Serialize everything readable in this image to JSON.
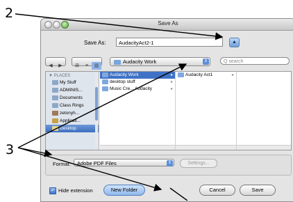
{
  "callouts": {
    "two": "2",
    "three": "3"
  },
  "dialog": {
    "title": "Save As",
    "save_as_label": "Save As:",
    "save_as_value": "AudacityAct2-1",
    "expand_symbol": "▲"
  },
  "toolbar": {
    "back": "◀",
    "forward": "▶",
    "view_icons": "⊞",
    "view_list": "≡",
    "view_columns": "▥",
    "location": "Audacity Work",
    "search_placeholder": "Q search"
  },
  "sidebar": {
    "heading": "▼ PLACES",
    "items": [
      "My Stuff",
      "ADMINIS...",
      "Documents",
      "Class Rings",
      "zetonyh...",
      "Applicati...",
      "Desktop"
    ]
  },
  "columns": {
    "col1": [
      "Audacity Work",
      "desktop stuff",
      "Music Cre... Audacity"
    ],
    "col2": [
      "Audacity Act1"
    ]
  },
  "format": {
    "label": "Format:",
    "value": "Adobe PDF Files",
    "settings": "Settings..."
  },
  "bottom": {
    "hide_extension": "Hide extension",
    "new_folder": "New Folder",
    "cancel": "Cancel",
    "save": "Save"
  }
}
